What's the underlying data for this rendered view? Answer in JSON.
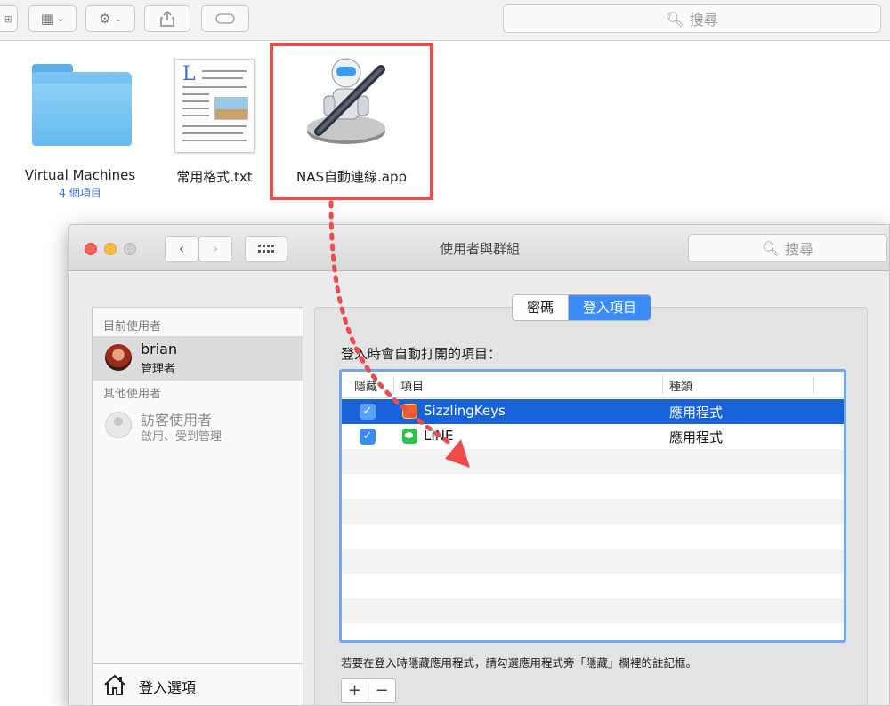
{
  "finder": {
    "search_placeholder": "搜尋",
    "files": [
      {
        "name": "Virtual Machines",
        "sub": "4 個項目"
      },
      {
        "name": "常用格式.txt"
      },
      {
        "name": "NAS自動連線.app"
      }
    ]
  },
  "prefs": {
    "window_title": "使用者與群組",
    "search_placeholder": "搜尋",
    "sidebar": {
      "current_users_header": "目前使用者",
      "other_users_header": "其他使用者",
      "current_user": {
        "name": "brian",
        "role": "管理者"
      },
      "guest_user": {
        "name": "訪客使用者",
        "role": "啟用、受到管理"
      },
      "login_options": "登入選項"
    },
    "tabs": [
      {
        "label": "密碼",
        "active": false
      },
      {
        "label": "登入項目",
        "active": true
      }
    ],
    "section_title": "登入時會自動打開的項目：",
    "table": {
      "columns": [
        "隱藏",
        "項目",
        "種類"
      ],
      "rows": [
        {
          "hidden": true,
          "name": "SizzlingKeys",
          "kind": "應用程式",
          "selected": true
        },
        {
          "hidden": true,
          "name": "LINE",
          "kind": "應用程式",
          "selected": false
        }
      ]
    },
    "hint": "若要在登入時隱藏應用程式，請勾選應用程式旁「隱藏」欄裡的註記框。",
    "add_label": "+",
    "remove_label": "−"
  },
  "colors": {
    "highlight_red": "#ee4b4b",
    "selection_blue": "#1762d8",
    "accent_blue": "#3b8cf5"
  }
}
